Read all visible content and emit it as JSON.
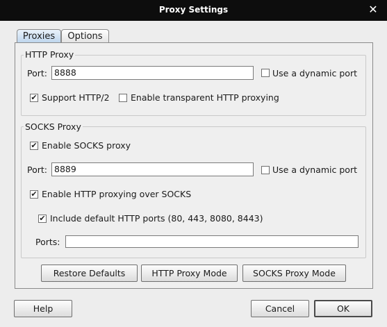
{
  "window": {
    "title": "Proxy Settings",
    "close_glyph": "✕"
  },
  "tabs": [
    {
      "label": "Proxies"
    },
    {
      "label": "Options"
    }
  ],
  "http_proxy": {
    "title": "HTTP Proxy",
    "port_label": "Port:",
    "port_value": "8888",
    "dynamic_port": {
      "label": "Use a dynamic port",
      "checked": false
    },
    "support_http2": {
      "label": "Support HTTP/2",
      "checked": true
    },
    "transparent": {
      "label": "Enable transparent HTTP proxying",
      "checked": false
    }
  },
  "socks_proxy": {
    "title": "SOCKS Proxy",
    "enable": {
      "label": "Enable SOCKS proxy",
      "checked": true
    },
    "port_label": "Port:",
    "port_value": "8889",
    "dynamic_port": {
      "label": "Use a dynamic port",
      "checked": false
    },
    "http_over_socks": {
      "label": "Enable HTTP proxying over SOCKS",
      "checked": true
    },
    "default_ports": {
      "label": "Include default HTTP ports (80, 443, 8080, 8443)",
      "checked": true
    },
    "ports_label": "Ports:",
    "ports_value": ""
  },
  "panel_buttons": {
    "restore": "Restore Defaults",
    "http_mode": "HTTP Proxy Mode",
    "socks_mode": "SOCKS Proxy Mode"
  },
  "footer": {
    "help": "Help",
    "cancel": "Cancel",
    "ok": "OK"
  },
  "checkmark": "✔"
}
